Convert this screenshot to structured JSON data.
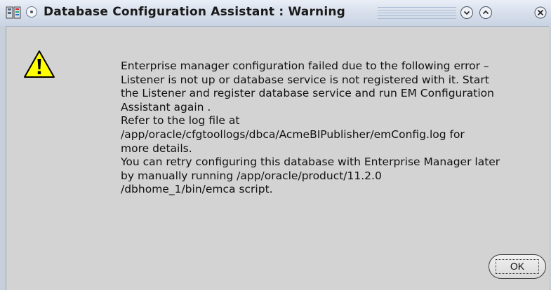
{
  "window": {
    "title": "Database Configuration Assistant : Warning",
    "app_icon": "database-app-icon",
    "menu_icon": "window-menu-icon",
    "controls": [
      "minimize-icon",
      "maximize-icon",
      "close-icon"
    ]
  },
  "dialog": {
    "icon": "warning-icon",
    "accent_color": "#ffff00",
    "message_lines": [
      "Enterprise manager configuration failed due to the following error –",
      "Listener is not up or database service is not registered with it. Start",
      "the Listener and register database service and run EM Configuration",
      "Assistant again .",
      "Refer to the log file at",
      "/app/oracle/cfgtoollogs/dbca/AcmeBIPublisher/emConfig.log for",
      "more details.",
      "You can retry configuring this database with Enterprise Manager later",
      "by manually running /app/oracle/product/11.2.0",
      "/dbhome_1/bin/emca script."
    ],
    "ok_label": "OK"
  }
}
